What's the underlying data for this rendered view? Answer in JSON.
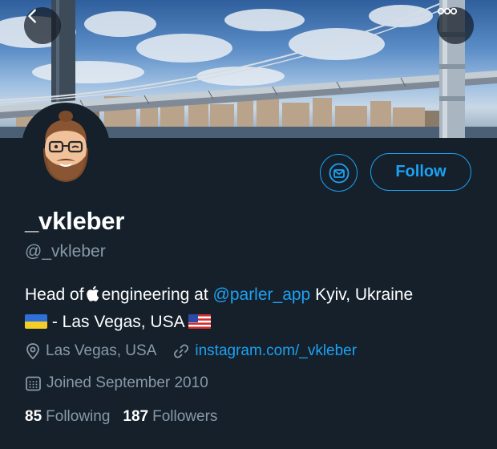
{
  "header": {
    "back_icon": "chevron-left-icon",
    "more_icon": "more-horizontal-icon"
  },
  "profile": {
    "name": "_vkleber",
    "handle": "@_vkleber",
    "bio": {
      "part1": "Head of",
      "apple_icon": "apple-logo-icon",
      "part2": "engineering at",
      "mention": "@parler_app",
      "part3": "Kyiv, Ukraine",
      "flag1": "ukraine-flag-icon",
      "part4": "- Las Vegas, USA",
      "flag2": "usa-flag-icon"
    },
    "location": "Las Vegas, USA",
    "website": "instagram.com/_vkleber",
    "joined": "Joined September 2010",
    "following_count": "85",
    "following_label": "Following",
    "followers_count": "187",
    "followers_label": "Followers"
  },
  "actions": {
    "message_icon": "mail-icon",
    "follow_label": "Follow"
  },
  "colors": {
    "background": "#15202b",
    "accent": "#1da1f2",
    "secondary_text": "#8899a6",
    "primary_text": "#ffffff"
  }
}
